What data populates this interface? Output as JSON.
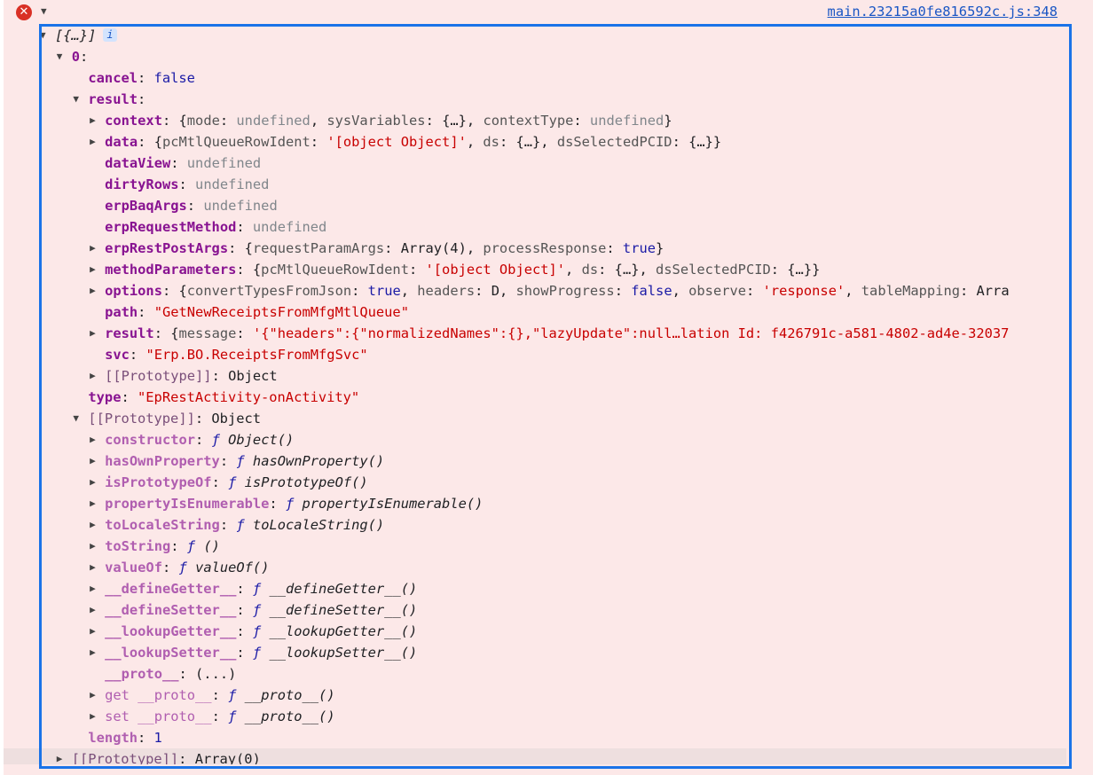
{
  "source_link": "main.23215a0fe816592c.js:348",
  "info_badge": "i",
  "icons": {
    "error": "error-circle-icon",
    "expanded": "triangle-down-icon",
    "collapsed": "triangle-right-icon"
  },
  "colors": {
    "highlight_border": "#1a73e8",
    "error": "#d93025",
    "key": "#881391",
    "string": "#c80000",
    "keyword": "#1a1aa6"
  },
  "rows": [
    {
      "level": 0,
      "arrow": "exp",
      "seg": [
        [
          "[{…}]",
          "it"
        ]
      ],
      "badge": true
    },
    {
      "level": 1,
      "arrow": "exp",
      "seg": [
        [
          "0",
          "k"
        ],
        [
          ":",
          ""
        ]
      ]
    },
    {
      "level": 2,
      "arrow": "",
      "seg": [
        [
          "cancel",
          "k"
        ],
        [
          ": ",
          ""
        ],
        [
          "false",
          "b"
        ]
      ]
    },
    {
      "level": 2,
      "arrow": "exp",
      "seg": [
        [
          "result",
          "k"
        ],
        [
          ":",
          ""
        ]
      ]
    },
    {
      "level": 3,
      "arrow": "col",
      "seg": [
        [
          "context",
          "k"
        ],
        [
          ": {",
          ""
        ],
        [
          "mode",
          "pk"
        ],
        [
          ": ",
          ""
        ],
        [
          "undefined",
          "u"
        ],
        [
          ", ",
          ""
        ],
        [
          "sysVariables",
          "pk"
        ],
        [
          ": {…}, ",
          ""
        ],
        [
          "contextType",
          "pk"
        ],
        [
          ": ",
          ""
        ],
        [
          "undefined",
          "u"
        ],
        [
          "}",
          ""
        ]
      ]
    },
    {
      "level": 3,
      "arrow": "col",
      "seg": [
        [
          "data",
          "k"
        ],
        [
          ": {",
          ""
        ],
        [
          "pcMtlQueueRowIdent",
          "pk"
        ],
        [
          ": ",
          ""
        ],
        [
          "'[object Object]'",
          "s"
        ],
        [
          ", ",
          ""
        ],
        [
          "ds",
          "pk"
        ],
        [
          ": {…}, ",
          ""
        ],
        [
          "dsSelectedPCID",
          "pk"
        ],
        [
          ": {…}}",
          ""
        ]
      ]
    },
    {
      "level": 3,
      "arrow": "",
      "seg": [
        [
          "dataView",
          "k"
        ],
        [
          ": ",
          ""
        ],
        [
          "undefined",
          "u"
        ]
      ]
    },
    {
      "level": 3,
      "arrow": "",
      "seg": [
        [
          "dirtyRows",
          "k"
        ],
        [
          ": ",
          ""
        ],
        [
          "undefined",
          "u"
        ]
      ]
    },
    {
      "level": 3,
      "arrow": "",
      "seg": [
        [
          "erpBaqArgs",
          "k"
        ],
        [
          ": ",
          ""
        ],
        [
          "undefined",
          "u"
        ]
      ]
    },
    {
      "level": 3,
      "arrow": "",
      "seg": [
        [
          "erpRequestMethod",
          "k"
        ],
        [
          ": ",
          ""
        ],
        [
          "undefined",
          "u"
        ]
      ]
    },
    {
      "level": 3,
      "arrow": "col",
      "seg": [
        [
          "erpRestPostArgs",
          "k"
        ],
        [
          ": {",
          ""
        ],
        [
          "requestParamArgs",
          "pk"
        ],
        [
          ": Array(4), ",
          ""
        ],
        [
          "processResponse",
          "pk"
        ],
        [
          ": ",
          ""
        ],
        [
          "true",
          "b"
        ],
        [
          "}",
          ""
        ]
      ]
    },
    {
      "level": 3,
      "arrow": "col",
      "seg": [
        [
          "methodParameters",
          "k"
        ],
        [
          ": {",
          ""
        ],
        [
          "pcMtlQueueRowIdent",
          "pk"
        ],
        [
          ": ",
          ""
        ],
        [
          "'[object Object]'",
          "s"
        ],
        [
          ", ",
          ""
        ],
        [
          "ds",
          "pk"
        ],
        [
          ": {…}, ",
          ""
        ],
        [
          "dsSelectedPCID",
          "pk"
        ],
        [
          ": {…}}",
          ""
        ]
      ]
    },
    {
      "level": 3,
      "arrow": "col",
      "seg": [
        [
          "options",
          "k"
        ],
        [
          ": {",
          ""
        ],
        [
          "convertTypesFromJson",
          "pk"
        ],
        [
          ": ",
          ""
        ],
        [
          "true",
          "b"
        ],
        [
          ", ",
          ""
        ],
        [
          "headers",
          "pk"
        ],
        [
          ": D, ",
          ""
        ],
        [
          "showProgress",
          "pk"
        ],
        [
          ": ",
          ""
        ],
        [
          "false",
          "b"
        ],
        [
          ", ",
          ""
        ],
        [
          "observe",
          "pk"
        ],
        [
          ": ",
          ""
        ],
        [
          "'response'",
          "s"
        ],
        [
          ", ",
          ""
        ],
        [
          "tableMapping",
          "pk"
        ],
        [
          ": Arra",
          ""
        ]
      ]
    },
    {
      "level": 3,
      "arrow": "",
      "seg": [
        [
          "path",
          "k"
        ],
        [
          ": ",
          ""
        ],
        [
          "\"GetNewReceiptsFromMfgMtlQueue\"",
          "s"
        ]
      ]
    },
    {
      "level": 3,
      "arrow": "col",
      "seg": [
        [
          "result",
          "k"
        ],
        [
          ": {",
          ""
        ],
        [
          "message",
          "pk"
        ],
        [
          ": ",
          ""
        ],
        [
          "'{\"headers\":{\"normalizedNames\":{},\"lazyUpdate\":null…lation Id: f426791c-a581-4802-ad4e-32037",
          "s"
        ]
      ]
    },
    {
      "level": 3,
      "arrow": "",
      "seg": [
        [
          "svc",
          "k"
        ],
        [
          ": ",
          ""
        ],
        [
          "\"Erp.BO.ReceiptsFromMfgSvc\"",
          "s"
        ]
      ]
    },
    {
      "level": 3,
      "arrow": "col",
      "seg": [
        [
          "[[Prototype]]",
          "kg"
        ],
        [
          ": Object",
          ""
        ]
      ]
    },
    {
      "level": 2,
      "arrow": "",
      "seg": [
        [
          "type",
          "k"
        ],
        [
          ": ",
          ""
        ],
        [
          "\"EpRestActivity-onActivity\"",
          "s"
        ]
      ]
    },
    {
      "level": 2,
      "arrow": "exp",
      "seg": [
        [
          "[[Prototype]]",
          "kg"
        ],
        [
          ": Object",
          ""
        ]
      ]
    },
    {
      "level": 3,
      "arrow": "col",
      "seg": [
        [
          "constructor",
          "kdb"
        ],
        [
          ": ",
          ""
        ],
        [
          "ƒ",
          "fs"
        ],
        [
          " Object()",
          "f"
        ]
      ]
    },
    {
      "level": 3,
      "arrow": "col",
      "seg": [
        [
          "hasOwnProperty",
          "kdb"
        ],
        [
          ": ",
          ""
        ],
        [
          "ƒ",
          "fs"
        ],
        [
          " hasOwnProperty()",
          "f"
        ]
      ]
    },
    {
      "level": 3,
      "arrow": "col",
      "seg": [
        [
          "isPrototypeOf",
          "kdb"
        ],
        [
          ": ",
          ""
        ],
        [
          "ƒ",
          "fs"
        ],
        [
          " isPrototypeOf()",
          "f"
        ]
      ]
    },
    {
      "level": 3,
      "arrow": "col",
      "seg": [
        [
          "propertyIsEnumerable",
          "kdb"
        ],
        [
          ": ",
          ""
        ],
        [
          "ƒ",
          "fs"
        ],
        [
          " propertyIsEnumerable()",
          "f"
        ]
      ]
    },
    {
      "level": 3,
      "arrow": "col",
      "seg": [
        [
          "toLocaleString",
          "kdb"
        ],
        [
          ": ",
          ""
        ],
        [
          "ƒ",
          "fs"
        ],
        [
          " toLocaleString()",
          "f"
        ]
      ]
    },
    {
      "level": 3,
      "arrow": "col",
      "seg": [
        [
          "toString",
          "kdb"
        ],
        [
          ": ",
          ""
        ],
        [
          "ƒ",
          "fs"
        ],
        [
          " ()",
          "f"
        ]
      ]
    },
    {
      "level": 3,
      "arrow": "col",
      "seg": [
        [
          "valueOf",
          "kdb"
        ],
        [
          ": ",
          ""
        ],
        [
          "ƒ",
          "fs"
        ],
        [
          " valueOf()",
          "f"
        ]
      ]
    },
    {
      "level": 3,
      "arrow": "col",
      "seg": [
        [
          "__defineGetter__",
          "kdb"
        ],
        [
          ": ",
          ""
        ],
        [
          "ƒ",
          "fs"
        ],
        [
          " __defineGetter__()",
          "f"
        ]
      ]
    },
    {
      "level": 3,
      "arrow": "col",
      "seg": [
        [
          "__defineSetter__",
          "kdb"
        ],
        [
          ": ",
          ""
        ],
        [
          "ƒ",
          "fs"
        ],
        [
          " __defineSetter__()",
          "f"
        ]
      ]
    },
    {
      "level": 3,
      "arrow": "col",
      "seg": [
        [
          "__lookupGetter__",
          "kdb"
        ],
        [
          ": ",
          ""
        ],
        [
          "ƒ",
          "fs"
        ],
        [
          " __lookupGetter__()",
          "f"
        ]
      ]
    },
    {
      "level": 3,
      "arrow": "col",
      "seg": [
        [
          "__lookupSetter__",
          "kdb"
        ],
        [
          ": ",
          ""
        ],
        [
          "ƒ",
          "fs"
        ],
        [
          " __lookupSetter__()",
          "f"
        ]
      ]
    },
    {
      "level": 3,
      "arrow": "",
      "seg": [
        [
          "__proto__",
          "kdb"
        ],
        [
          ": (...)",
          ""
        ]
      ]
    },
    {
      "level": 3,
      "arrow": "col",
      "seg": [
        [
          "get __proto__",
          "kd"
        ],
        [
          ": ",
          ""
        ],
        [
          "ƒ",
          "fs"
        ],
        [
          " __proto__()",
          "f"
        ]
      ]
    },
    {
      "level": 3,
      "arrow": "col",
      "seg": [
        [
          "set __proto__",
          "kd"
        ],
        [
          ": ",
          ""
        ],
        [
          "ƒ",
          "fs"
        ],
        [
          " __proto__()",
          "f"
        ]
      ]
    },
    {
      "level": 2,
      "arrow": "",
      "seg": [
        [
          "length",
          "kdb"
        ],
        [
          ": ",
          ""
        ],
        [
          "1",
          "b"
        ]
      ]
    },
    {
      "level": 1,
      "arrow": "col",
      "seg": [
        [
          "[[Prototype]]",
          "kg"
        ],
        [
          ": Array(0)",
          ""
        ]
      ],
      "highlight": true
    }
  ]
}
